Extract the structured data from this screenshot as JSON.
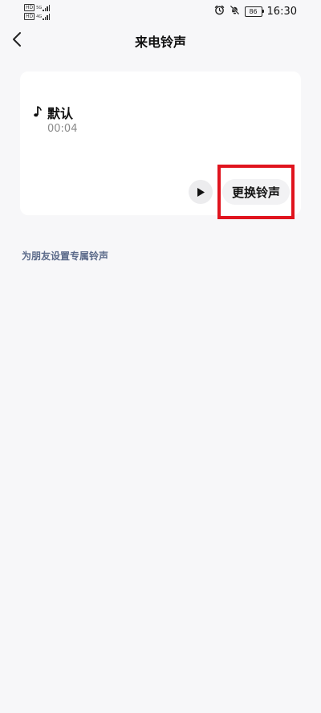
{
  "status_bar": {
    "sim1_tag": "HD",
    "sim2_tag": "HD",
    "sim1_net": "5G",
    "sim2_net": "4G",
    "battery": "86",
    "time": "16:30",
    "icons": [
      "alarm-icon",
      "mute-icon",
      "battery-icon"
    ]
  },
  "nav": {
    "title": "来电铃声",
    "back_icon": "chevron-left-icon"
  },
  "ringtone_card": {
    "icon": "music-note-icon",
    "name": "默认",
    "duration": "00:04",
    "play_icon": "play-icon",
    "change_label": "更换铃声"
  },
  "friend_link": {
    "label": "为朋友设置专属铃声"
  },
  "colors": {
    "background": "#f7f7f9",
    "card": "#ffffff",
    "link": "#5b6a8a",
    "highlight": "#e0141e"
  }
}
